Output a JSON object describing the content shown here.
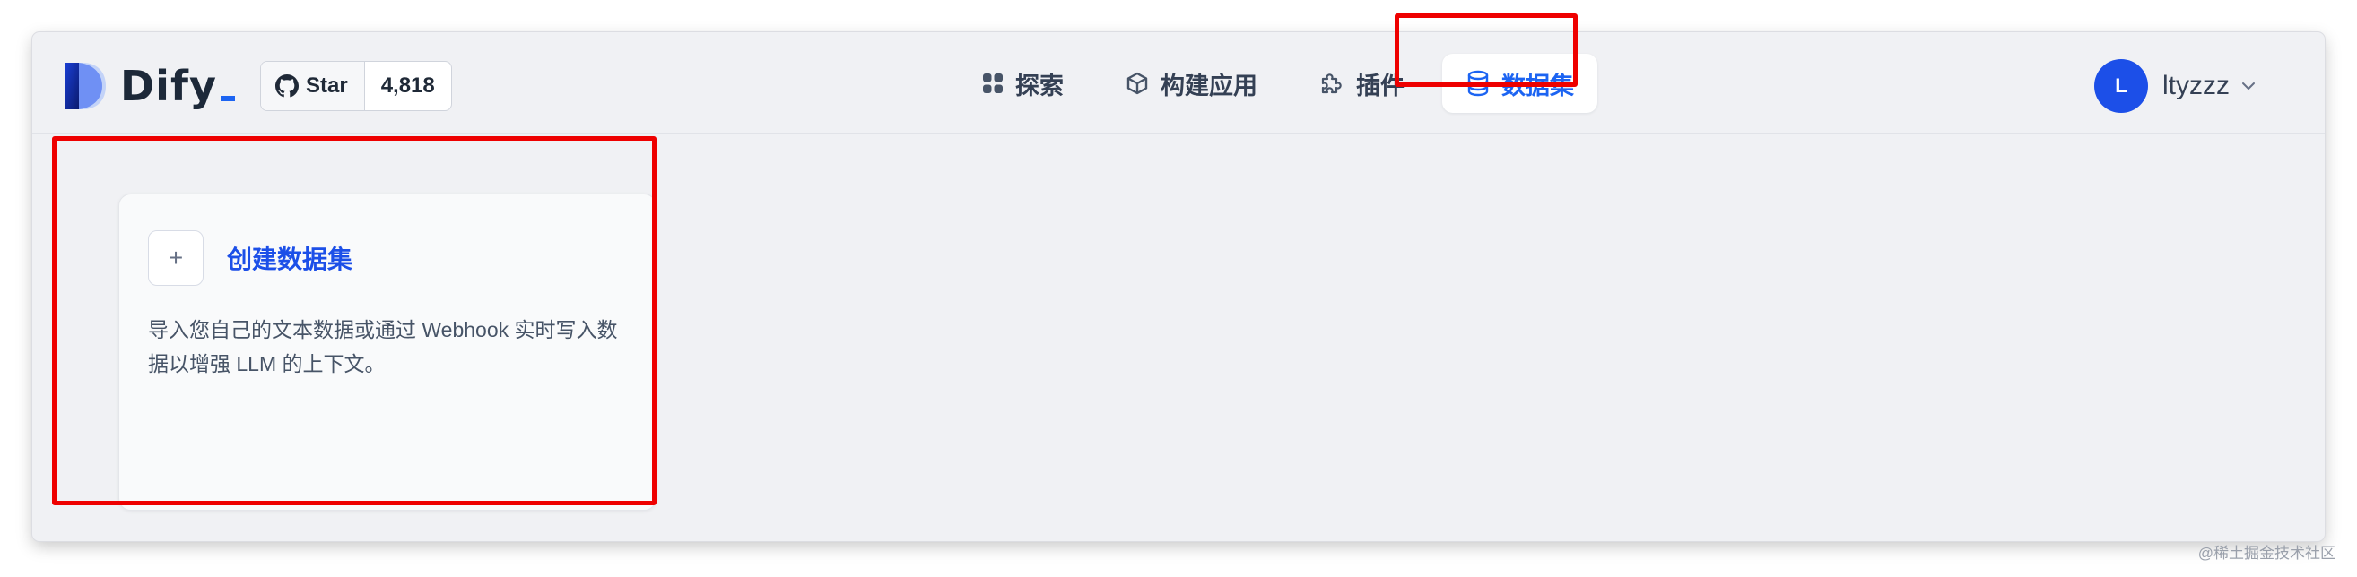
{
  "app": {
    "name": "Dify",
    "brand_color": "#1c64f2"
  },
  "github": {
    "star_label": "Star",
    "star_count": "4,818",
    "icon": "github-icon"
  },
  "nav": {
    "items": [
      {
        "label": "探索",
        "icon": "grid-icon",
        "active": false
      },
      {
        "label": "构建应用",
        "icon": "cube-icon",
        "active": false
      },
      {
        "label": "插件",
        "icon": "puzzle-icon",
        "active": false
      },
      {
        "label": "数据集",
        "icon": "database-icon",
        "active": true
      }
    ]
  },
  "user": {
    "initial": "L",
    "name": "ltyzzz"
  },
  "card": {
    "title": "创建数据集",
    "description": "导入您自己的文本数据或通过 Webhook 实时写入数据以增强 LLM 的上下文。"
  },
  "highlight_color": "#ee0000",
  "watermark": "@稀土掘金技术社区"
}
